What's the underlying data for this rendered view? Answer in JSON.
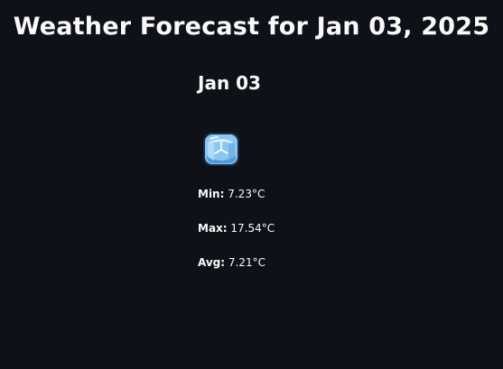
{
  "page": {
    "title": "Weather Forecast for Jan 03, 2025"
  },
  "forecast": {
    "day_label": "Jan 03",
    "icon": "ice-cube-icon",
    "min_label": "Min:",
    "min_value": "7.23°C",
    "max_label": "Max:",
    "max_value": "17.54°C",
    "avg_label": "Avg:",
    "avg_value": "7.21°C"
  },
  "colors": {
    "background": "#0e1117",
    "text": "#fafafa",
    "icon_light": "#cfe9fb",
    "icon_mid": "#7fbfef",
    "icon_dark": "#3e8fd2"
  }
}
